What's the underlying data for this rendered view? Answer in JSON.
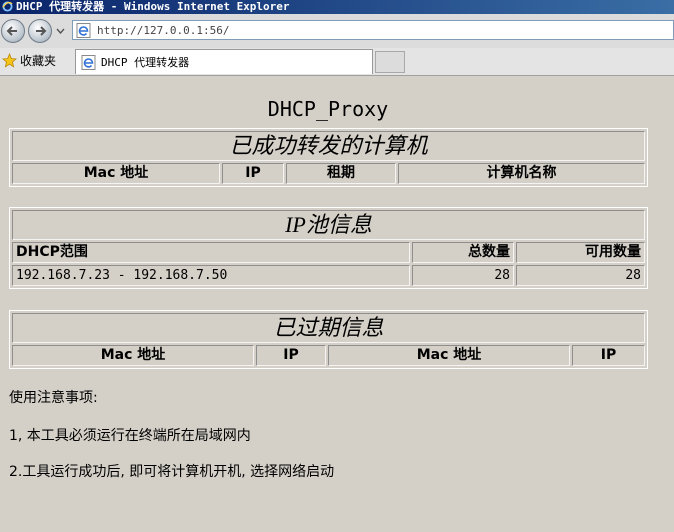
{
  "window": {
    "title": "DHCP 代理转发器 - Windows Internet Explorer"
  },
  "browser": {
    "address": "http://127.0.0.1:56/",
    "favorites_label": "收藏夹",
    "tab_title": "DHCP 代理转发器"
  },
  "page": {
    "title": "DHCP_Proxy",
    "forwarded": {
      "caption": "已成功转发的计算机",
      "headers": [
        "Mac 地址",
        "IP",
        "租期",
        "计算机名称"
      ]
    },
    "pool": {
      "caption": "IP池信息",
      "headers": [
        "DHCP范围",
        "总数量",
        "可用数量"
      ],
      "rows": [
        {
          "range": "192.168.7.23 - 192.168.7.50",
          "total": "28",
          "available": "28"
        }
      ]
    },
    "expired": {
      "caption": "已过期信息",
      "headers": [
        "Mac 地址",
        "IP",
        "Mac 地址",
        "IP"
      ]
    },
    "notes": {
      "heading": "使用注意事项:",
      "items": [
        "1, 本工具必须运行在终端所在局域网内",
        "2.工具运行成功后, 即可将计算机开机, 选择网络启动"
      ]
    }
  }
}
